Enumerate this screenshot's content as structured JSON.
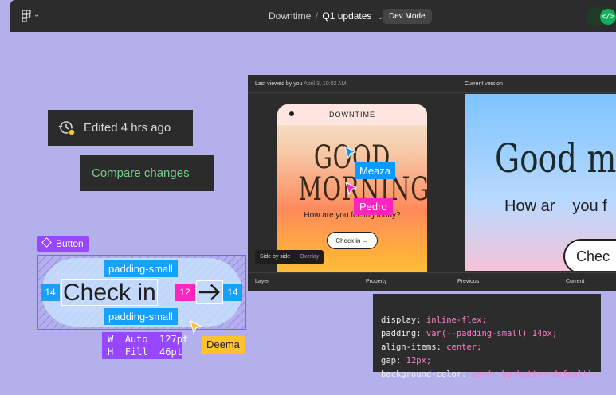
{
  "topbar": {
    "project": "Downtime",
    "separator": "/",
    "file": "Q1 updates",
    "mode_button": "Dev Mode",
    "dev_toggle_icon": "</>"
  },
  "canvas": {
    "edited_label": "Edited 4 hrs ago",
    "compare_button": "Compare changes",
    "component_tag": "Button",
    "padding_top": "padding-small",
    "padding_bottom": "padding-small",
    "spacing_left": "14",
    "spacing_gap": "12",
    "spacing_right": "14",
    "button_text": "Check in",
    "dims": {
      "w_label": "W",
      "w_mode": "Auto",
      "w_value": "127pt",
      "h_label": "H",
      "h_mode": "Fill",
      "h_value": "46pt"
    },
    "collaborator_deema": "Deema",
    "colors": {
      "component": "#9747ff",
      "spacing": "#18a0fb",
      "gap": "#ff24bd",
      "deema": "#ffc233"
    }
  },
  "compare_panel": {
    "left_header": "Last viewed by you",
    "left_header_date": "April 3, 10:02 AM",
    "right_header": "Current version",
    "phone": {
      "brand": "DOWNTIME",
      "headline_1": "GOOD",
      "headline_2": "MORNING",
      "question": "How are you feeling today?",
      "button": "Check in →"
    },
    "collaborator_meaza": "Meaza",
    "collaborator_pedro": "Pedro",
    "toggle": {
      "side_by_side": "Side by side",
      "overlay": "Overlay"
    },
    "right_preview": {
      "headline": "Good m",
      "question": "How ar",
      "question_tail": "you f",
      "button": "Chec"
    },
    "footer": {
      "layer": "Layer",
      "property": "Property",
      "previous": "Previous",
      "current": "Current"
    }
  },
  "code": {
    "lines": [
      {
        "prop": "display:",
        "val": "inline-flex;"
      },
      {
        "prop": "padding:",
        "val": "var(--padding-small) 14px;"
      },
      {
        "prop": "align-items:",
        "val": "center;"
      },
      {
        "prop": "gap:",
        "val": "12px;"
      },
      {
        "prop": "background-color:",
        "val": "var(--bg-button-default);"
      }
    ]
  }
}
